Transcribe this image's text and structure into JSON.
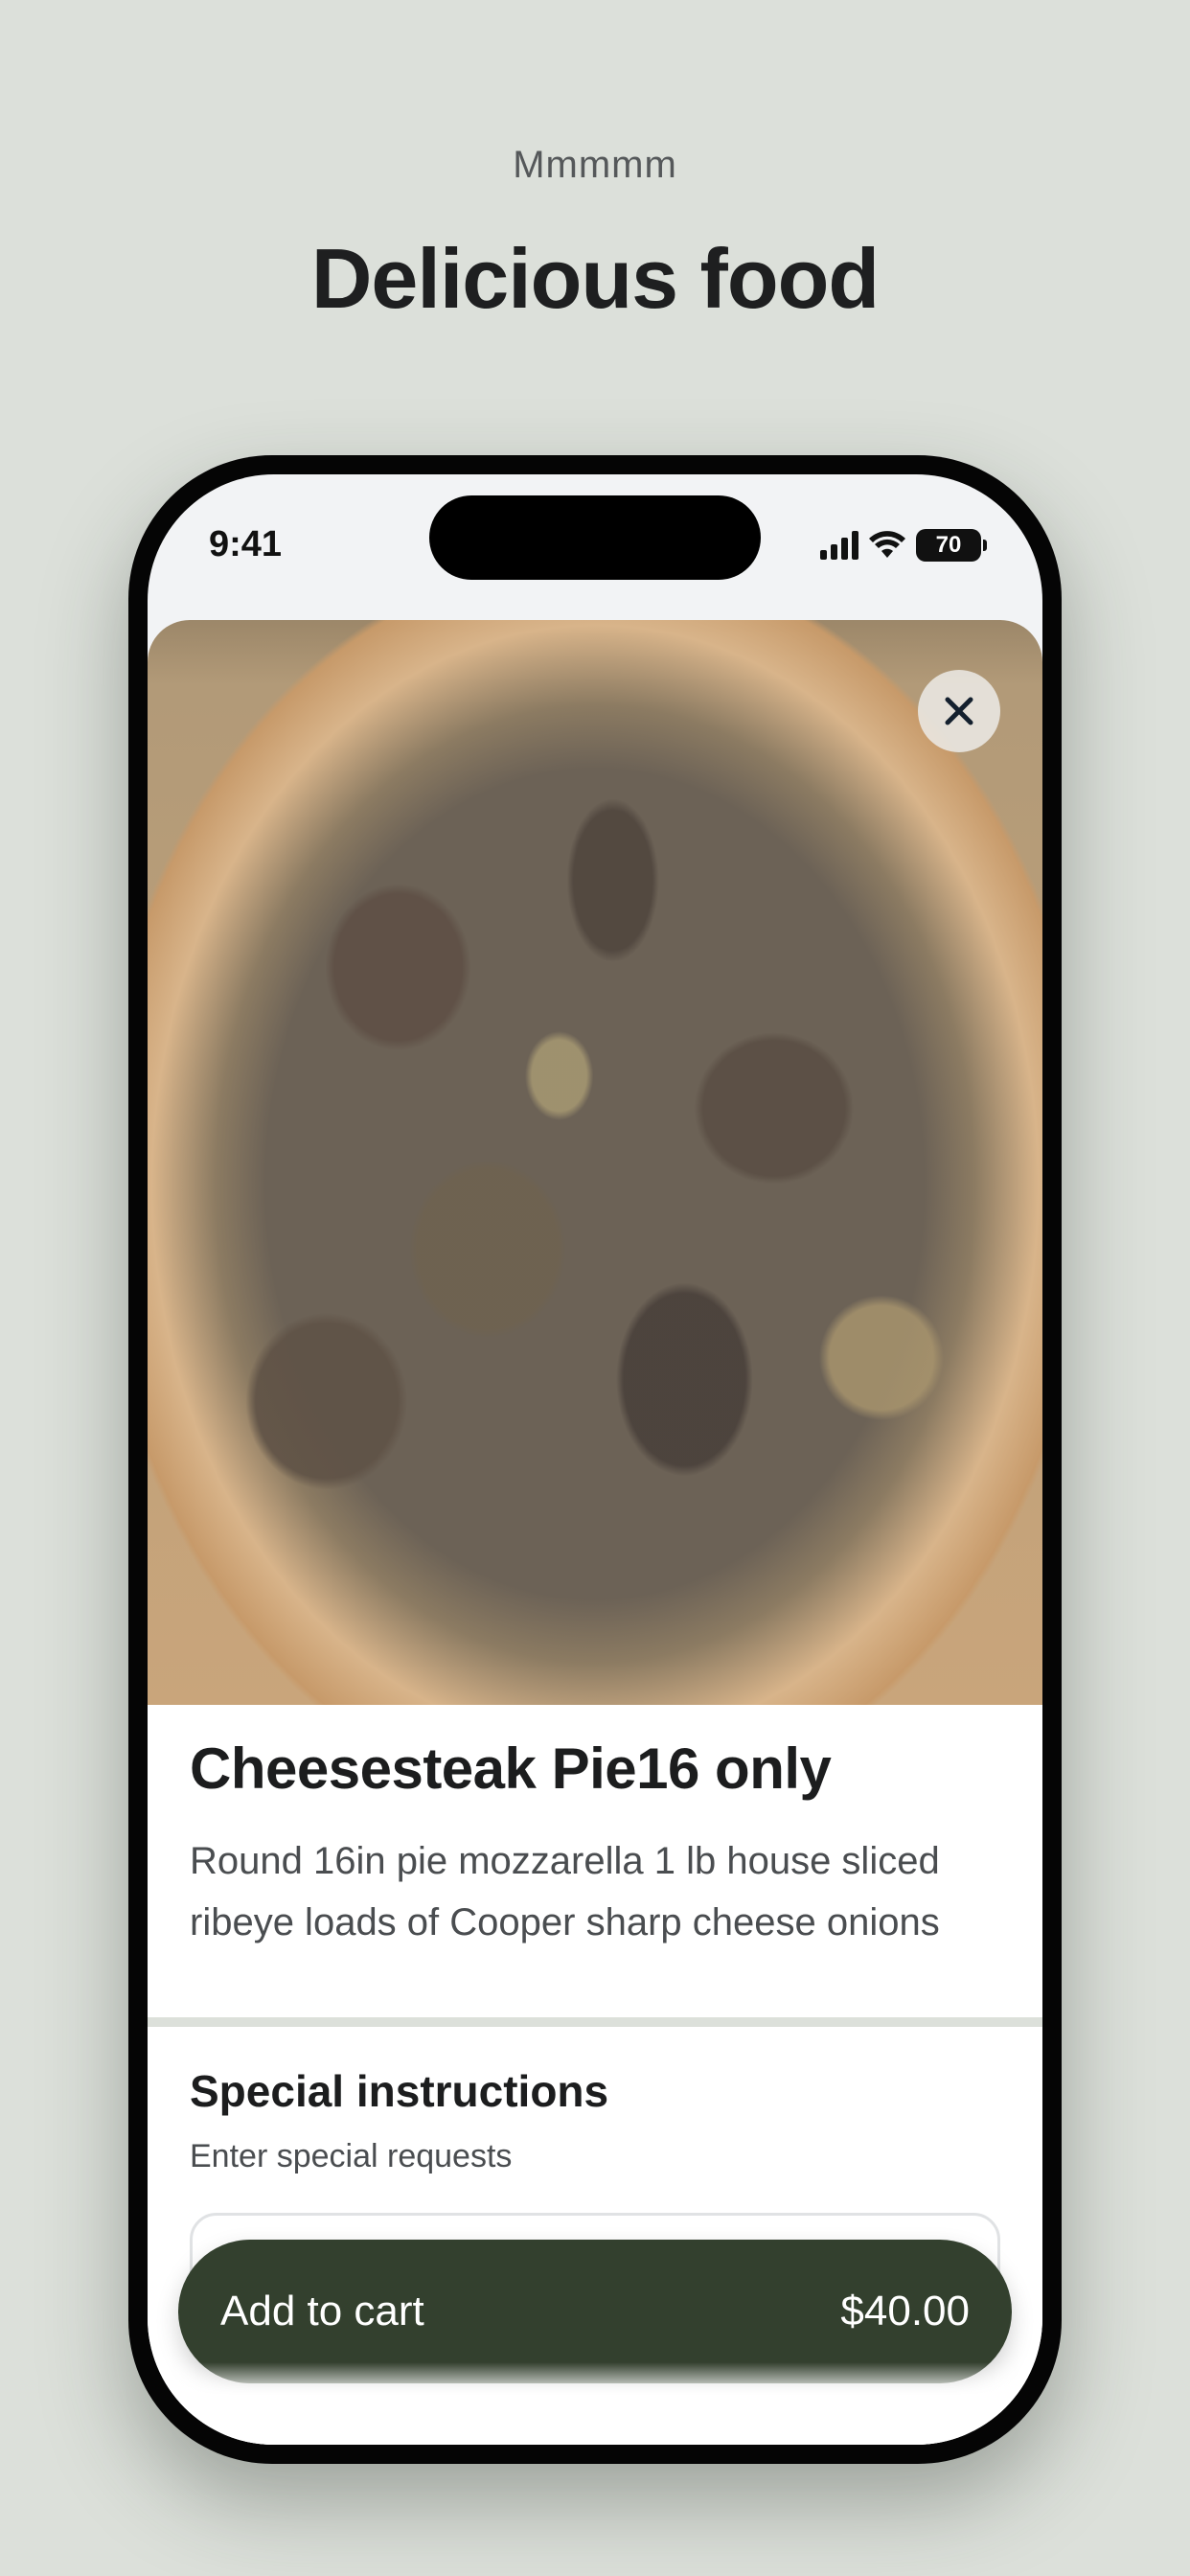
{
  "promo": {
    "eyebrow": "Mmmmm",
    "headline": "Delicious food"
  },
  "status_bar": {
    "time": "9:41",
    "battery": "70",
    "icons": [
      "signal-icon",
      "wifi-icon",
      "battery-icon"
    ]
  },
  "item": {
    "image_alt": "cheesesteak pizza photo",
    "close_icon": "close-icon",
    "title": "Cheesesteak Pie16 only",
    "description": "Round 16in pie mozzarella 1 lb house sliced ribeye loads of Cooper sharp cheese onions"
  },
  "special_instructions": {
    "title": "Special instructions",
    "subtitle": "Enter special requests",
    "value": ""
  },
  "cart": {
    "label": "Add to cart",
    "price": "$40.00"
  },
  "colors": {
    "background": "#DCE0DA",
    "cart_button": "#33402E",
    "text_primary": "#1C1D1E"
  }
}
